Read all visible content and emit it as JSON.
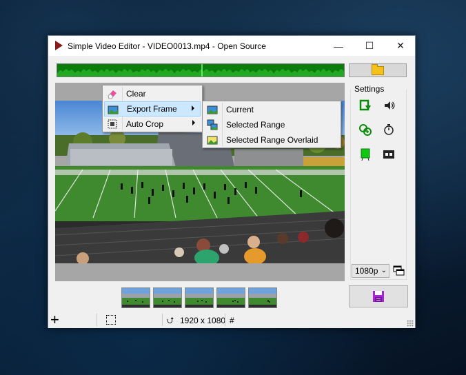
{
  "window": {
    "title": "Simple Video Editor - VIDEO0013.mp4 - Open Source",
    "minimize_glyph": "—",
    "maximize_glyph": "☐",
    "close_glyph": "✕"
  },
  "settings": {
    "label": "Settings"
  },
  "resolution": {
    "selected": "1080p",
    "chevron": "⌄"
  },
  "status": {
    "add_glyph": "+",
    "resolution_icon": "⮍",
    "resolution": "1920 x 1080",
    "hash": "#"
  },
  "context_menu": {
    "items": [
      {
        "label": "Clear",
        "icon": "eraser-icon"
      },
      {
        "label": "Export Frame",
        "icon": "picture-icon",
        "has_submenu": true
      },
      {
        "label": "Auto Crop",
        "icon": "crop-icon",
        "has_submenu": true
      }
    ]
  },
  "export_submenu": {
    "items": [
      {
        "label": "Current",
        "icon": "picture-icon"
      },
      {
        "label": "Selected Range",
        "icon": "pictures-icon"
      },
      {
        "label": "Selected Range Overlaid",
        "icon": "overlay-picture-icon"
      }
    ]
  },
  "thumbnails_count": 5,
  "colors": {
    "accent_green": "#008000",
    "save_purple": "#9b1fd1",
    "highlight": "#cce8ff"
  }
}
